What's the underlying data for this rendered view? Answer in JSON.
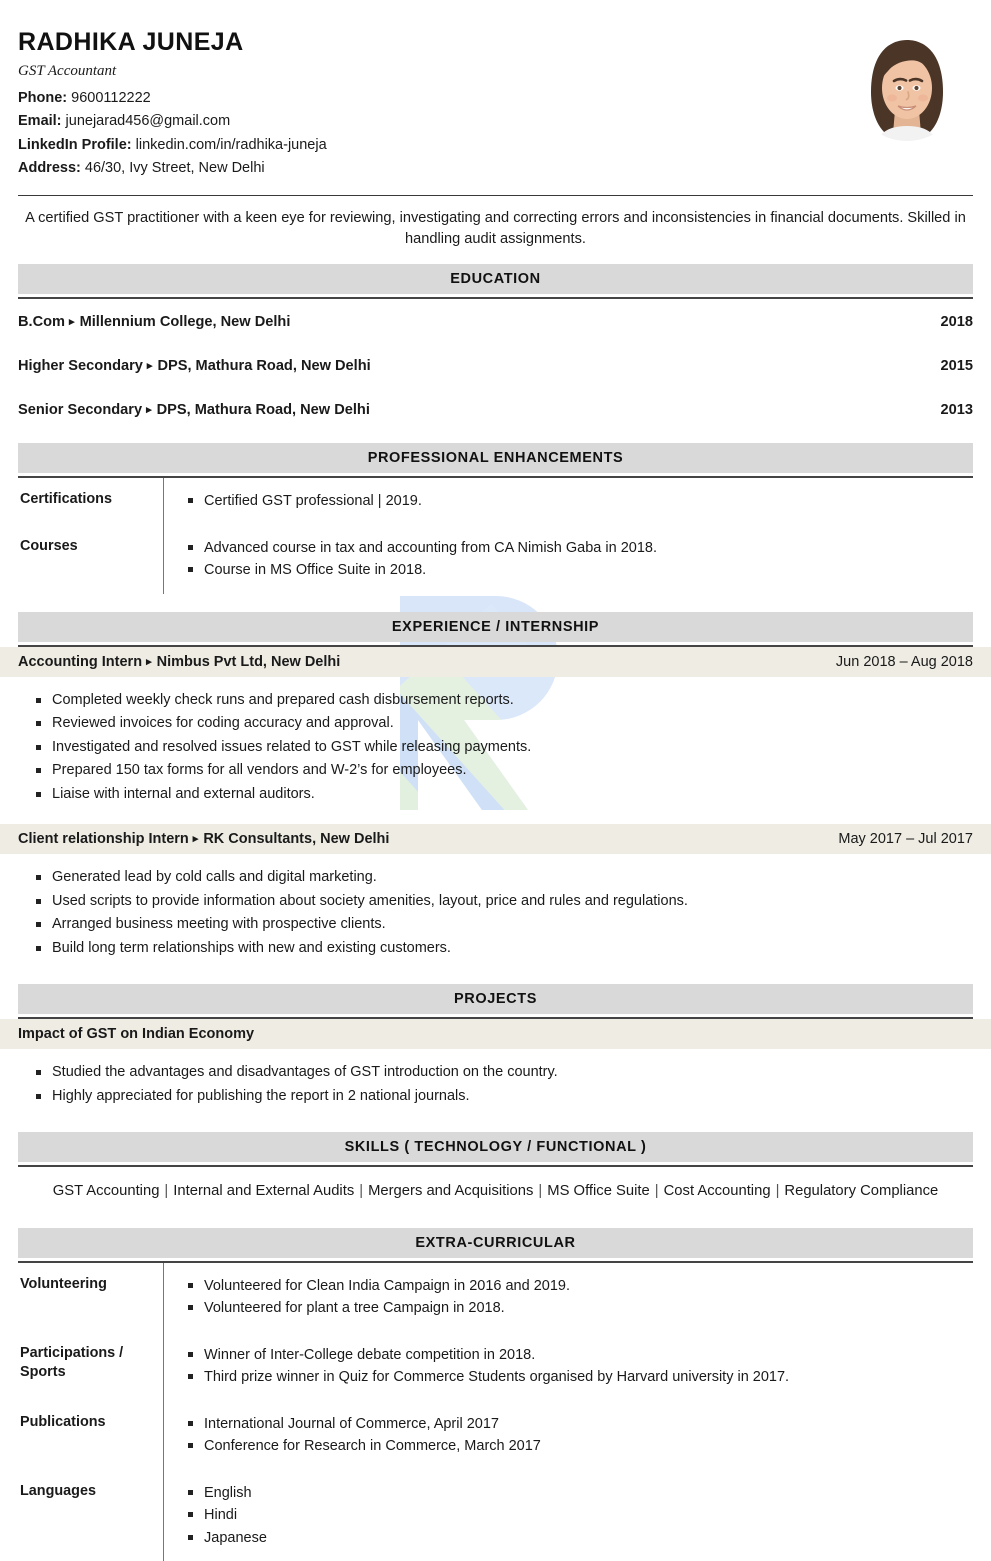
{
  "header": {
    "name": "RADHIKA JUNEJA",
    "role": "GST Accountant",
    "phone_label": "Phone:",
    "phone_value": "9600112222",
    "email_label": "Email:",
    "email_value": "junejarad456@gmail.com",
    "linkedin_label": "LinkedIn Profile:",
    "linkedin_value": "linkedin.com/in/radhika-juneja",
    "address_label": "Address:",
    "address_value": "46/30, Ivy Street, New Delhi",
    "photo_alt": "profile-photo"
  },
  "summary": "A certified GST practitioner with a keen eye for reviewing, investigating and correcting errors and inconsistencies in financial documents. Skilled in handling audit assignments.",
  "sections": {
    "education": "EDUCATION",
    "professional_enhancements": "PROFESSIONAL ENHANCEMENTS",
    "experience": "EXPERIENCE / INTERNSHIP",
    "projects": "PROJECTS",
    "skills": "SKILLS ( TECHNOLOGY / FUNCTIONAL )",
    "extra_curricular": "EXTRA-CURRICULAR"
  },
  "education": [
    {
      "degree": "B.Com",
      "institute": "Millennium College, New Delhi",
      "year": "2018"
    },
    {
      "degree": "Higher Secondary",
      "institute": "DPS, Mathura Road, New Delhi",
      "year": "2015"
    },
    {
      "degree": "Senior Secondary",
      "institute": "DPS, Mathura Road, New Delhi",
      "year": "2013"
    }
  ],
  "professional_enhancements": [
    {
      "label": "Certifications",
      "items": [
        "Certified GST professional | 2019."
      ]
    },
    {
      "label": "Courses",
      "items": [
        "Advanced course in tax and accounting from CA Nimish Gaba in 2018.",
        "Course in MS Office Suite in 2018."
      ]
    }
  ],
  "experience": [
    {
      "title": "Accounting Intern",
      "company": "Nimbus Pvt Ltd, New Delhi",
      "dates": "Jun 2018 – Aug 2018",
      "bullets": [
        "Completed weekly check runs and prepared cash disbursement reports.",
        "Reviewed invoices for coding accuracy and approval.",
        "Investigated and resolved issues related to GST while releasing payments.",
        "Prepared 150 tax forms for all vendors and W-2’s for employees.",
        "Liaise with internal and external auditors."
      ]
    },
    {
      "title": "Client relationship Intern",
      "company": "RK Consultants, New Delhi",
      "dates": "May 2017 – Jul 2017",
      "bullets": [
        "Generated lead by cold calls and digital marketing.",
        "Used scripts to provide information about society amenities, layout, price and rules and regulations.",
        "Arranged business meeting with prospective clients.",
        "Build long term relationships with new and existing customers."
      ]
    }
  ],
  "projects": [
    {
      "title": "Impact of GST on Indian Economy",
      "bullets": [
        "Studied the advantages and disadvantages of GST introduction on the country.",
        "Highly appreciated for publishing the report in 2 national journals."
      ]
    }
  ],
  "skills": [
    "GST Accounting",
    "Internal and External Audits",
    "Mergers and Acquisitions",
    "MS Office Suite",
    "Cost Accounting",
    "Regulatory Compliance"
  ],
  "extra_curricular": [
    {
      "label": "Volunteering",
      "items": [
        "Volunteered for Clean India Campaign in 2016 and 2019.",
        "Volunteered for plant a tree Campaign in 2018."
      ]
    },
    {
      "label": "Participations / Sports",
      "items": [
        "Winner of Inter-College debate competition in 2018.",
        "Third prize winner in Quiz for Commerce Students organised by Harvard university in 2017."
      ]
    },
    {
      "label": "Publications",
      "items": [
        "International Journal of Commerce, April 2017",
        "Conference for Research in Commerce, March 2017"
      ]
    },
    {
      "label": "Languages",
      "items": [
        "English",
        "Hindi",
        "Japanese"
      ]
    }
  ],
  "colors": {
    "section_bar": "#d9d9d9",
    "entry_bar": "#efece3",
    "watermark_blue": "#d6e4f7",
    "watermark_green": "#dfeedd",
    "text": "#1a1a1a"
  }
}
